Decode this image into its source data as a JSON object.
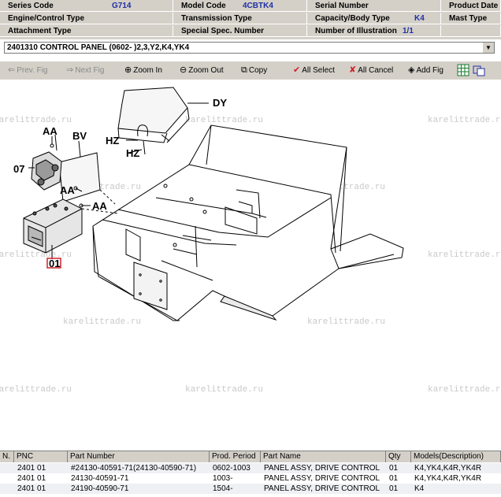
{
  "header": {
    "series_code_label": "Series Code",
    "series_code_value": "G714",
    "model_code_label": "Model Code",
    "model_code_value": "4CBTK4",
    "serial_number_label": "Serial Number",
    "product_date_label": "Product Date",
    "engine_label": "Engine/Control Type",
    "transmission_label": "Transmission Type",
    "capacity_label": "Capacity/Body Type",
    "capacity_value": "K4",
    "mast_label": "Mast Type",
    "attachment_label": "Attachment Type",
    "special_spec_label": "Special Spec. Number",
    "illustration_label": "Number of Illustration",
    "illustration_value": "1/1"
  },
  "group_select": {
    "value": "2401310  CONTROL PANEL  (0602-   )2,3,Y2,K4,YK4"
  },
  "toolbar": {
    "prev_fig": "Prev. Fig",
    "next_fig": "Next Fig",
    "zoom_in": "Zoom In",
    "zoom_out": "Zoom Out",
    "copy": "Copy",
    "all_select": "All Select",
    "all_cancel": "All Cancel",
    "add_fig": "Add Fig"
  },
  "drawing": {
    "watermark": "karelittrade.ru",
    "callouts": [
      "AA",
      "BV",
      "07",
      "AA",
      "AA",
      "01",
      "DY",
      "HZ",
      "HZ"
    ]
  },
  "table": {
    "columns": [
      "N.",
      "PNC",
      "Part Number",
      "Prod. Period",
      "Part Name",
      "Qty",
      "Models(Description)"
    ],
    "rows": [
      {
        "n": "",
        "pnc": "2401 01",
        "part": "#24130-40591-71(24130-40590-71)",
        "period": "0602-1003",
        "name": "PANEL ASSY, DRIVE CONTROL",
        "qty": "01",
        "models": "K4,YK4,K4R,YK4R"
      },
      {
        "n": "",
        "pnc": "2401 01",
        "part": "24130-40591-71",
        "period": "1003-",
        "name": "PANEL ASSY, DRIVE CONTROL",
        "qty": "01",
        "models": "K4,YK4,K4R,YK4R"
      },
      {
        "n": "",
        "pnc": "2401 01",
        "part": "24190-40590-71",
        "period": "1504-",
        "name": "PANEL ASSY, DRIVE CONTROL",
        "qty": "01",
        "models": "K4"
      }
    ]
  },
  "colors": {
    "value_text": "#1f2fa6",
    "chrome": "#d4d0c8",
    "highlight_box": "#d0202a"
  }
}
